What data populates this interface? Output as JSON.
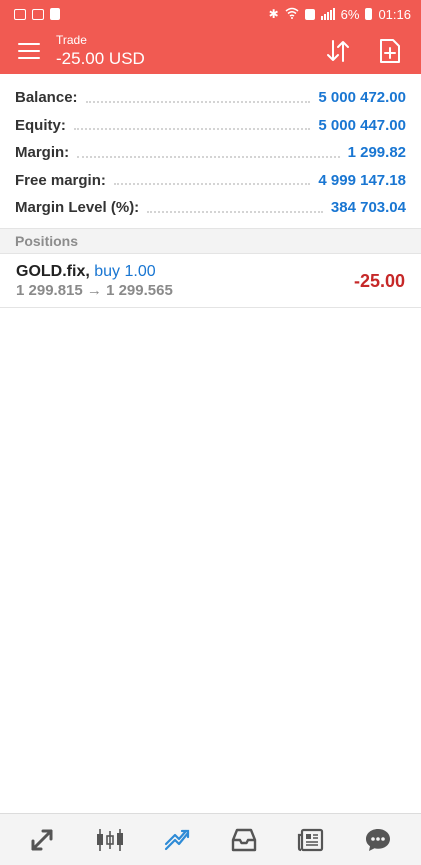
{
  "status_bar": {
    "battery": "6%",
    "time": "01:16"
  },
  "header": {
    "title": "Trade",
    "subtitle": "-25.00 USD"
  },
  "summary": [
    {
      "label": "Balance:",
      "value": "5 000 472.00"
    },
    {
      "label": "Equity:",
      "value": "5 000 447.00"
    },
    {
      "label": "Margin:",
      "value": "1 299.82"
    },
    {
      "label": "Free margin:",
      "value": "4 999 147.18"
    },
    {
      "label": "Margin Level (%):",
      "value": "384 703.04"
    }
  ],
  "positions": {
    "header": "Positions",
    "items": [
      {
        "symbol": "GOLD.fix,",
        "side": "buy 1.00",
        "prices": "1 299.815 → 1 299.565",
        "profit": "-25.00"
      }
    ]
  },
  "bottom_nav": [
    {
      "icon": "quotes-icon"
    },
    {
      "icon": "chart-icon"
    },
    {
      "icon": "trade-icon",
      "active": true
    },
    {
      "icon": "history-icon"
    },
    {
      "icon": "news-icon"
    },
    {
      "icon": "chat-icon"
    }
  ],
  "colors": {
    "header_bg": "#f15a52",
    "value_blue": "#1976d2",
    "loss_red": "#c62828"
  }
}
